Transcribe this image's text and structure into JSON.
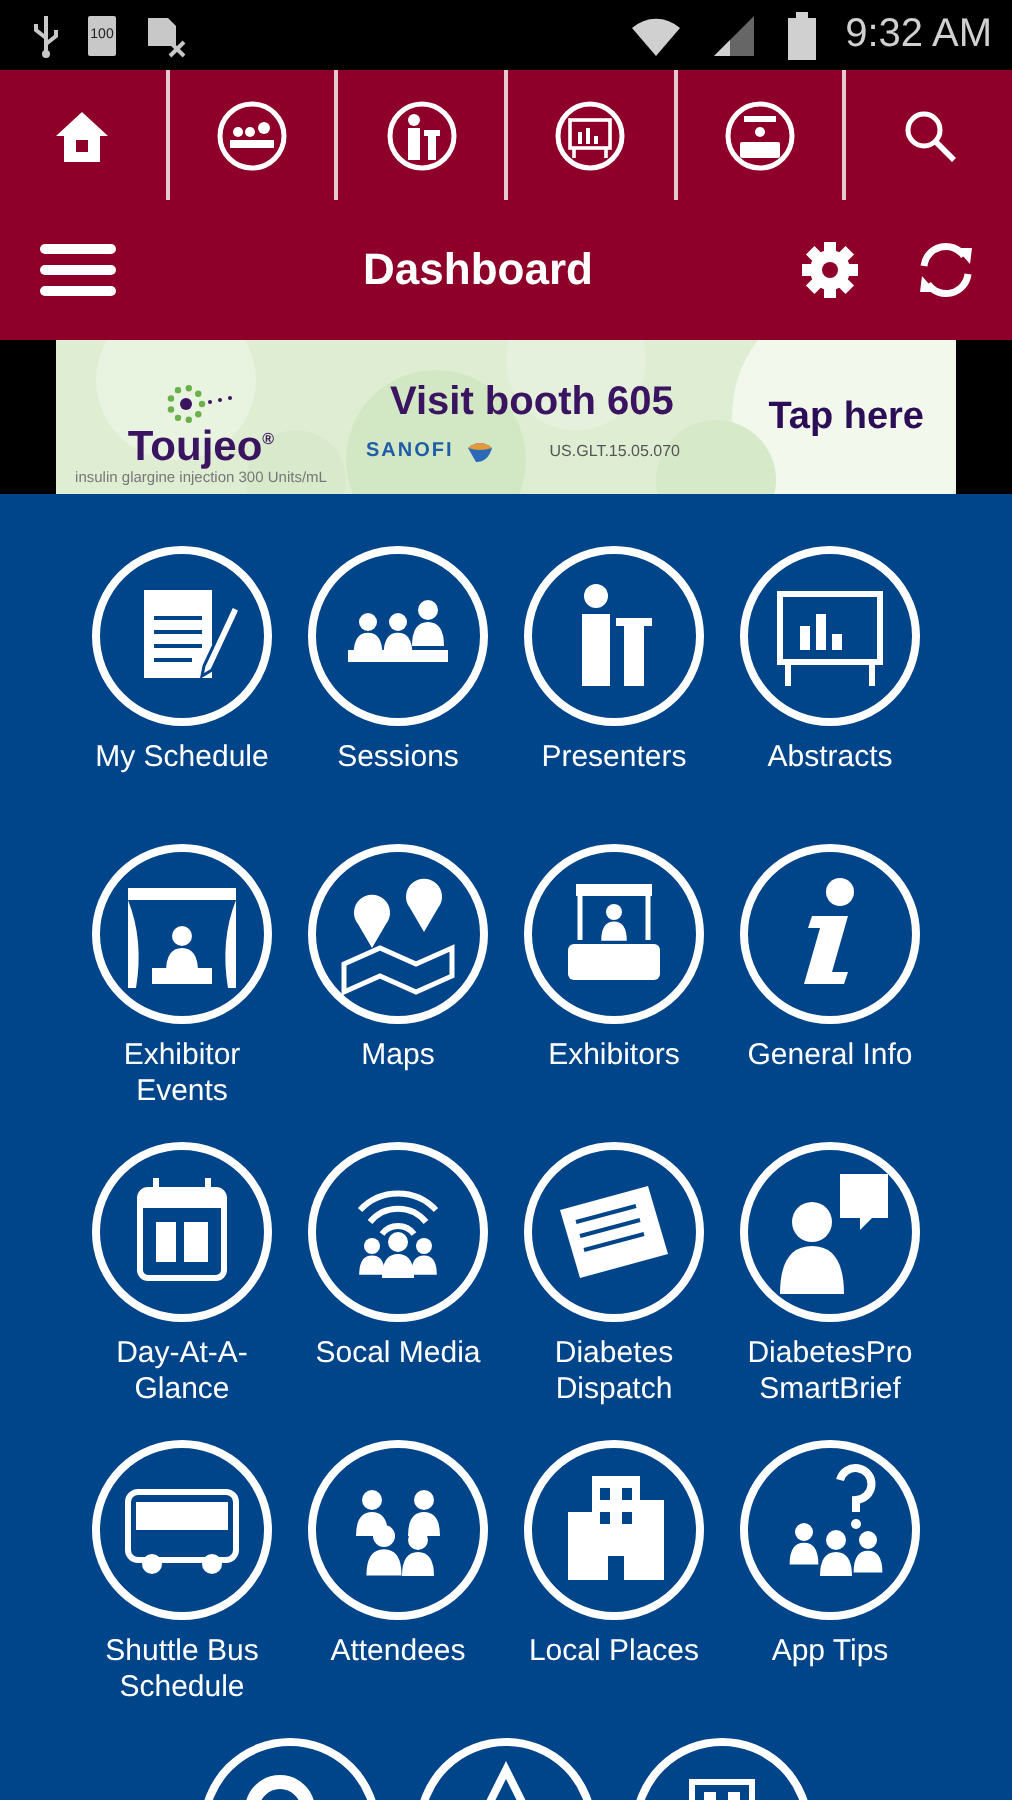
{
  "status_bar": {
    "battery_card": "100",
    "time": "9:32 AM"
  },
  "header": {
    "title": "Dashboard"
  },
  "ad": {
    "brand": "Toujeo$^{®}$",
    "subtitle": "insulin glargine injection 300 Units/mL",
    "headline": "Visit booth 605",
    "company": "SANOFI",
    "code": "US.GLT.15.05.070",
    "action": "Tap here"
  },
  "tiles": [
    {
      "kind": "labeled",
      "label": "My Schedule"
    },
    {
      "kind": "labeled",
      "label": "Sessions"
    },
    {
      "kind": "labeled",
      "label": "Presenters"
    },
    {
      "kind": "labeled",
      "label": "Abstracts"
    },
    {
      "kind": "labeled",
      "label": "Exhibitor Events"
    },
    {
      "kind": "labeled",
      "label": "Maps"
    },
    {
      "kind": "labeled",
      "label": "Exhibitors"
    },
    {
      "kind": "labeled",
      "label": "General Info"
    },
    {
      "kind": "labeled",
      "label": "Day-At-A-Glance"
    },
    {
      "kind": "labeled",
      "label": "Socal Media"
    },
    {
      "kind": "labeled",
      "label": "Diabetes Dispatch"
    },
    {
      "kind": "labeled",
      "label": "DiabetesPro SmartBrief"
    },
    {
      "kind": "labeled",
      "label": "Shuttle Bus Schedule"
    },
    {
      "kind": "labeled",
      "label": "Attendees"
    },
    {
      "kind": "labeled",
      "label": "Local Places"
    },
    {
      "kind": "labeled",
      "label": "App Tips"
    },
    {
      "kind": "icon_only"
    },
    {
      "kind": "icon_only"
    },
    {
      "kind": "icon_only"
    }
  ]
}
